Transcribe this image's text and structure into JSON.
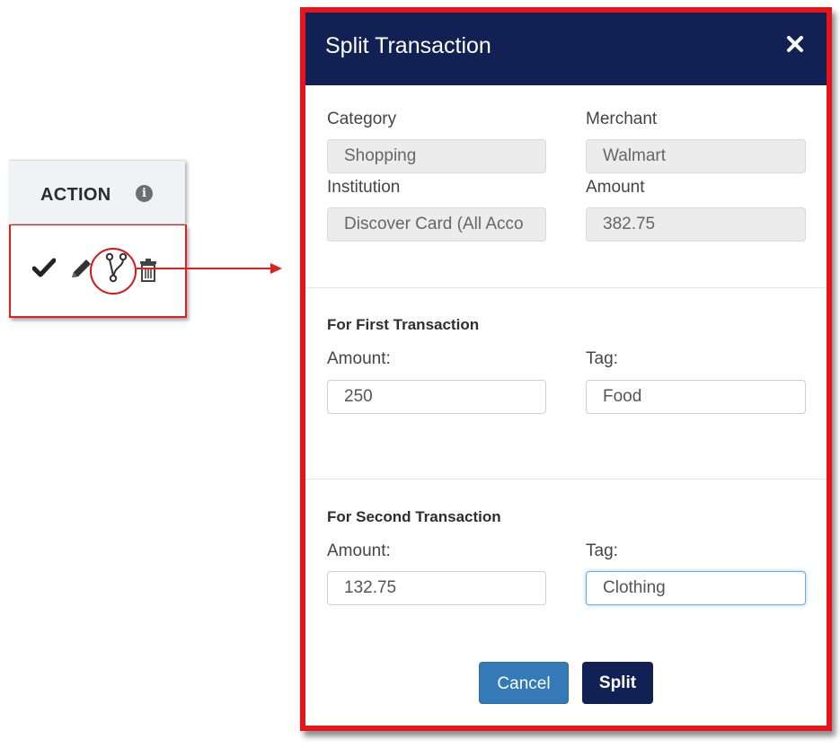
{
  "action_panel": {
    "header_label": "ACTION",
    "info_glyph": "i",
    "icons": [
      "check-icon",
      "pencil-icon",
      "fork-icon",
      "trash-icon"
    ]
  },
  "modal": {
    "title": "Split Transaction",
    "close_glyph": "×",
    "category": {
      "label": "Category",
      "value": "Shopping"
    },
    "merchant": {
      "label": "Merchant",
      "value": "Walmart"
    },
    "institution": {
      "label": "Institution",
      "value": "Discover Card (All Acco"
    },
    "amount": {
      "label": "Amount",
      "value": "382.75"
    },
    "first": {
      "title": "For First Transaction",
      "amount_label": "Amount:",
      "amount_value": "250",
      "tag_label": "Tag:",
      "tag_value": "Food"
    },
    "second": {
      "title": "For Second Transaction",
      "amount_label": "Amount:",
      "amount_value": "132.75",
      "tag_label": "Tag:",
      "tag_value": "Clothing"
    },
    "buttons": {
      "cancel": "Cancel",
      "split": "Split"
    }
  },
  "colors": {
    "header_bg": "#122154",
    "highlight_red": "#e8141c",
    "cancel_blue": "#337ab7"
  }
}
